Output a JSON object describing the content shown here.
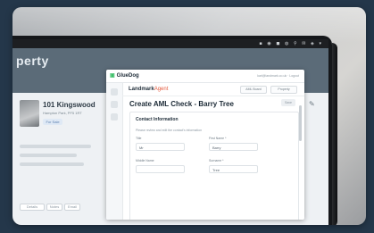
{
  "macbar": {
    "status_icons": "▪ ◉ ◼ ◍ ⚲ ✉ ◈ ▾"
  },
  "background_app": {
    "title": "perty",
    "property_address": "101 Kingswood",
    "property_sub": "Hampton Park, PF5 1RT",
    "badge": "For Sale",
    "buttons": [
      "Details",
      "Notes",
      "Email"
    ],
    "right_icon": "✎"
  },
  "panel": {
    "brand_logo": "GlueDog",
    "header_right": "karl@landmark.co.uk   ·   Logout",
    "agent_brand_a": "Landmark",
    "agent_brand_b": "Agent",
    "top_buttons": [
      "AML Board",
      "Property"
    ],
    "title": "Create AML Check - Barry Tree",
    "save_label": "Save",
    "contact": {
      "title": "Contact Information",
      "desc": "Please review and edit the contact's information",
      "fields": [
        {
          "label": "Title",
          "value": "Mr"
        },
        {
          "label": "First Name *",
          "value": "Barry"
        },
        {
          "label": "Middle Name",
          "value": ""
        },
        {
          "label": "Surname *",
          "value": "Tree"
        }
      ]
    }
  }
}
